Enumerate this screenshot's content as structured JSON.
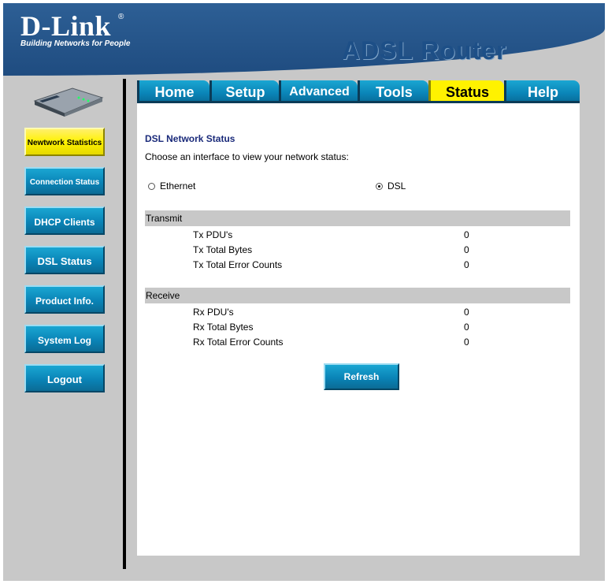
{
  "header": {
    "logo": "D-Link",
    "tagline": "Building Networks for People",
    "product": "ADSL Router"
  },
  "tabs": [
    {
      "label": "Home",
      "active": false
    },
    {
      "label": "Setup",
      "active": false
    },
    {
      "label": "Advanced",
      "active": false
    },
    {
      "label": "Tools",
      "active": false
    },
    {
      "label": "Status",
      "active": true
    },
    {
      "label": "Help",
      "active": false
    }
  ],
  "sidebar": {
    "items": [
      {
        "label": "Newtwork Statistics",
        "active": true
      },
      {
        "label": "Connection Status",
        "active": false
      },
      {
        "label": "DHCP Clients",
        "active": false
      },
      {
        "label": "DSL Status",
        "active": false
      },
      {
        "label": "Product Info.",
        "active": false
      },
      {
        "label": "System Log",
        "active": false
      },
      {
        "label": "Logout",
        "active": false
      }
    ]
  },
  "content": {
    "title": "DSL Network Status",
    "description": "Choose an interface to view your network status:",
    "interfaces": [
      {
        "label": "Ethernet",
        "checked": false
      },
      {
        "label": "DSL",
        "checked": true
      }
    ],
    "transmit": {
      "heading": "Transmit",
      "rows": [
        {
          "label": "Tx PDU's",
          "value": "0"
        },
        {
          "label": "Tx Total Bytes",
          "value": "0"
        },
        {
          "label": "Tx Total Error Counts",
          "value": "0"
        }
      ]
    },
    "receive": {
      "heading": "Receive",
      "rows": [
        {
          "label": "Rx PDU's",
          "value": "0"
        },
        {
          "label": "Rx Total Bytes",
          "value": "0"
        },
        {
          "label": "Rx Total Error Counts",
          "value": "0"
        }
      ]
    },
    "refresh_label": "Refresh"
  },
  "colors": {
    "brand_blue": "#1f4c80",
    "button_blue": "#0a84b7",
    "active_yellow": "#fff200"
  }
}
